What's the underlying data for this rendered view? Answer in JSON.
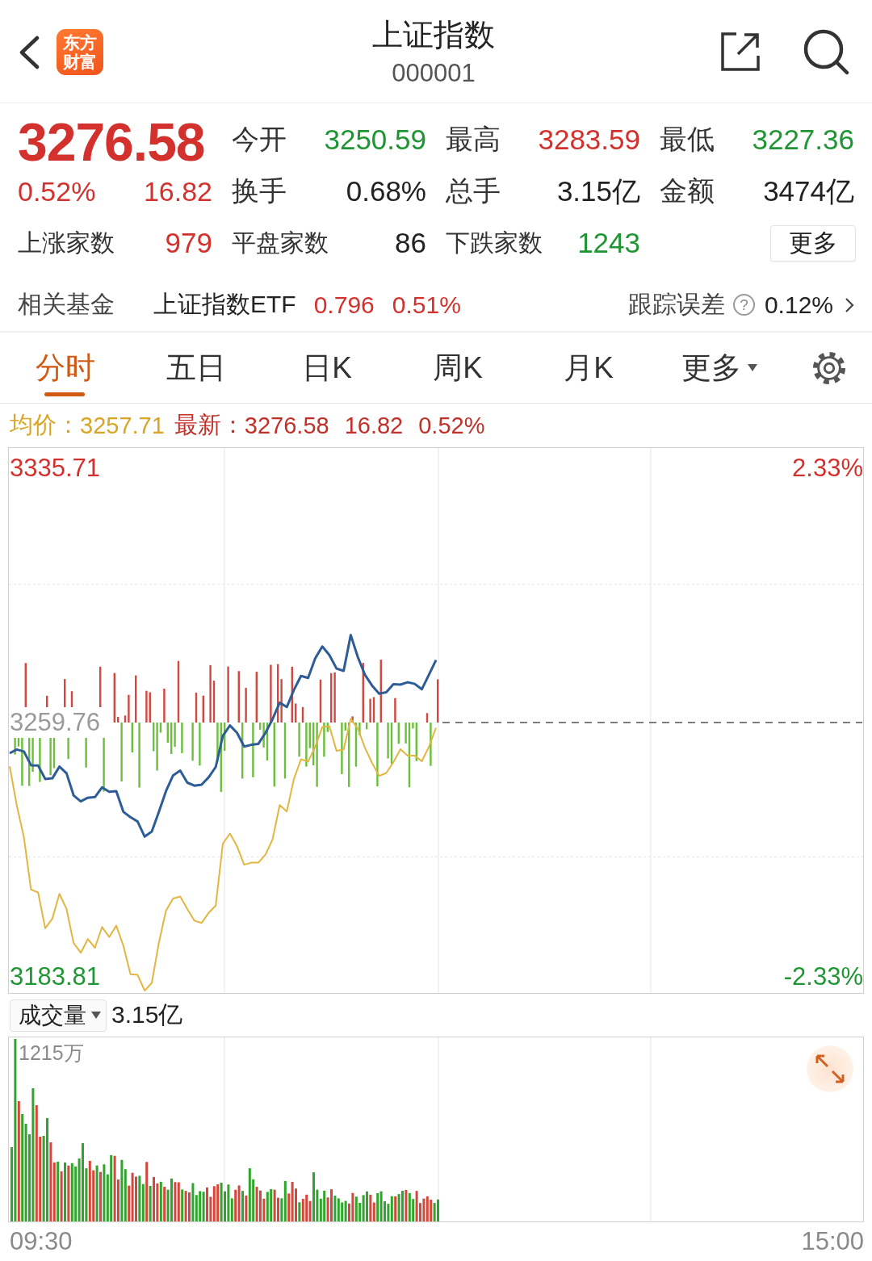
{
  "header": {
    "logo_text": "东方财富",
    "title": "上证指数",
    "code": "000001"
  },
  "quote": {
    "price": "3276.58",
    "change_percent": "0.52%",
    "change": "16.82",
    "stats": [
      {
        "label": "今开",
        "value": "3250.59",
        "color": "#1f9633"
      },
      {
        "label": "最高",
        "value": "3283.59",
        "color": "#d3312d"
      },
      {
        "label": "最低",
        "value": "3227.36",
        "color": "#1f9633"
      },
      {
        "label": "换手",
        "value": "0.68%",
        "color": "#222222"
      },
      {
        "label": "总手",
        "value": "3.15亿",
        "color": "#222222"
      },
      {
        "label": "金额",
        "value": "3474亿",
        "color": "#222222"
      }
    ],
    "breadth": [
      {
        "label": "上涨家数",
        "value": "979",
        "color": "#d3312d"
      },
      {
        "label": "平盘家数",
        "value": "86",
        "color": "#222222"
      },
      {
        "label": "下跌家数",
        "value": "1243",
        "color": "#1f9633"
      }
    ],
    "more_button": "更多"
  },
  "fund": {
    "label": "相关基金",
    "name": "上证指数ETF",
    "price": "0.796",
    "change": "0.51%",
    "tracking_label": "跟踪误差",
    "help": "?",
    "tracking_value": "0.12%"
  },
  "tabs": [
    {
      "label": "分时",
      "selected": true,
      "kind": "tab"
    },
    {
      "label": "五日",
      "selected": false,
      "kind": "tab"
    },
    {
      "label": "日K",
      "selected": false,
      "kind": "tab"
    },
    {
      "label": "周K",
      "selected": false,
      "kind": "tab"
    },
    {
      "label": "月K",
      "selected": false,
      "kind": "tab"
    },
    {
      "label": "更多",
      "selected": false,
      "kind": "menu"
    }
  ],
  "summary": {
    "average_label": "均价：",
    "average_value": "3257.71",
    "latest_label": "最新：",
    "latest_values": [
      "3276.58",
      "16.82",
      "0.52%"
    ]
  },
  "price_chart": {
    "right_ticks": [
      "2.33%",
      "-2.33%"
    ],
    "chart_data": {
      "type": "line",
      "categories": [
        null,
        null,
        null,
        null,
        null,
        null,
        null,
        null,
        null,
        null,
        null,
        null,
        null,
        null,
        null,
        null,
        null,
        null,
        null,
        null,
        null,
        null,
        null,
        null,
        null,
        null,
        null,
        null,
        null,
        null,
        null,
        null,
        null,
        null,
        null,
        null,
        null,
        null,
        null,
        null,
        null,
        null,
        null,
        null,
        null,
        null,
        null,
        null,
        null,
        null,
        null,
        null,
        null,
        null,
        null,
        null,
        null,
        null,
        null,
        null,
        null,
        null,
        null,
        null,
        null,
        null,
        null,
        null,
        null,
        null,
        null,
        null,
        null,
        null,
        null,
        null,
        null,
        null,
        null,
        null,
        null,
        null,
        null,
        null,
        null,
        null,
        null,
        null,
        null,
        null,
        null,
        null,
        null,
        null,
        null,
        null,
        null,
        null,
        null,
        null,
        null,
        null,
        null,
        null,
        null,
        null,
        null,
        null,
        null,
        null,
        null,
        null,
        null,
        null,
        null,
        null,
        null,
        null,
        null,
        null,
        null
      ],
      "ylim": [
        3178.99,
        3341.74
      ],
      "yticks": [
        {
          "value": 3183.81,
          "label": "3183.81"
        },
        {
          "value": 3259.76,
          "label": "3259.76"
        },
        {
          "value": 3335.71,
          "label": "3335.71"
        }
      ],
      "series": [
        {
          "color": "#2d5c96",
          "values": [
            3250.6,
            3251.7,
            3251.1,
            3247.0,
            3246.9,
            3242.9,
            3243.1,
            3246.6,
            3244.6,
            3238.0,
            3236.2,
            3237.3,
            3237.5,
            3240.4,
            3239.1,
            3239.3,
            3233.1,
            3231.5,
            3230.2,
            3225.7,
            3227.2,
            3233.1,
            3239.3,
            3244.0,
            3245.4,
            3241.8,
            3240.9,
            3241.2,
            3243.4,
            3246.5,
            3255.8,
            3258.9,
            3256.7,
            3252.6,
            3253.1,
            3253.4,
            3256.7,
            3260.8,
            3265.7,
            3264.4,
            3269.5,
            3273.7,
            3273.1,
            3278.9,
            3282.5,
            3279.9,
            3275.9,
            3275.2,
            3285.9,
            3279.3,
            3274.0,
            3270.8,
            3268.4,
            3268.8,
            3271.2,
            3271.1,
            3271.8,
            3271.3,
            3269.7,
            3274.0,
            3278.4,
            null,
            null,
            null,
            null,
            null,
            null,
            null,
            null,
            null,
            null,
            null,
            null,
            null,
            null,
            null,
            null,
            null,
            null,
            null,
            null,
            null,
            null,
            null,
            null,
            null,
            null,
            null,
            null,
            null,
            null,
            null,
            null,
            null,
            null,
            null,
            null,
            null,
            null,
            null,
            null,
            null,
            null,
            null,
            null,
            null,
            null,
            null,
            null,
            null,
            null,
            null,
            null,
            null,
            null,
            null,
            null,
            null,
            null,
            null,
            null
          ]
        },
        {
          "color": "#e3b541",
          "values": [
            3246.7,
            3235.0,
            3225.5,
            3209.9,
            3209.0,
            3198.3,
            3201.2,
            3208.6,
            3204.1,
            3193.9,
            3191.0,
            3195.1,
            3192.5,
            3198.7,
            3195.7,
            3199.1,
            3193.1,
            3184.6,
            3184.4,
            3179.7,
            3182.0,
            3194.0,
            3203.6,
            3207.2,
            3207.8,
            3204.1,
            3200.6,
            3199.9,
            3202.9,
            3205.1,
            3223.6,
            3226.6,
            3222.8,
            3217.3,
            3217.9,
            3217.9,
            3220.3,
            3224.9,
            3235.1,
            3233.2,
            3242.9,
            3248.8,
            3248.1,
            3252.5,
            3258.4,
            3258.6,
            3251.3,
            3251.7,
            3260.9,
            3257.9,
            3252.2,
            3247.7,
            3243.8,
            3244.7,
            3247.9,
            3251.8,
            3249.9,
            3249.9,
            3248.2,
            3252.5,
            3258.2,
            null,
            null,
            null,
            null,
            null,
            null,
            null,
            null,
            null,
            null,
            null,
            null,
            null,
            null,
            null,
            null,
            null,
            null,
            null,
            null,
            null,
            null,
            null,
            null,
            null,
            null,
            null,
            null,
            null,
            null,
            null,
            null,
            null,
            null,
            null,
            null,
            null,
            null,
            null,
            null,
            null,
            null,
            null,
            null,
            null,
            null,
            null,
            null,
            null,
            null,
            null,
            null,
            null,
            null,
            null,
            null,
            null,
            null,
            null,
            null
          ]
        }
      ]
    }
  },
  "volume": {
    "indicator": "成交量",
    "total": "3.15亿",
    "max_label": "1215万"
  },
  "time_axis": [
    "09:30",
    "15:00"
  ]
}
